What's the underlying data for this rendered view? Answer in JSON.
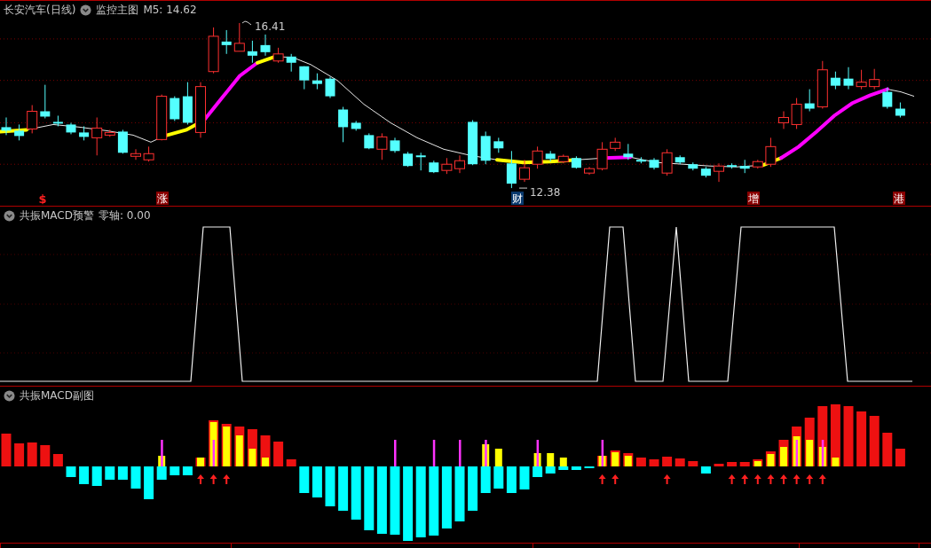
{
  "main_panel": {
    "title": "长安汽车(日线)",
    "indicator": "监控主图",
    "reading": "M5: 14.62",
    "high_label": "16.41",
    "low_label": "12.38",
    "markers": [
      {
        "label": "$",
        "kind": "symbol",
        "color": "#ff2020"
      },
      {
        "label": "涨",
        "kind": "badge",
        "color": "#8b0000"
      },
      {
        "label": "财",
        "kind": "badge",
        "color": "#0a3a6e"
      },
      {
        "label": "增",
        "kind": "badge",
        "color": "#8b0000"
      },
      {
        "label": "港",
        "kind": "badge",
        "color": "#8b0000"
      }
    ]
  },
  "warning_panel": {
    "title": "共振MACD预警",
    "reading": "零轴: 0.00"
  },
  "macd_panel": {
    "title": "共振MACD副图"
  }
}
